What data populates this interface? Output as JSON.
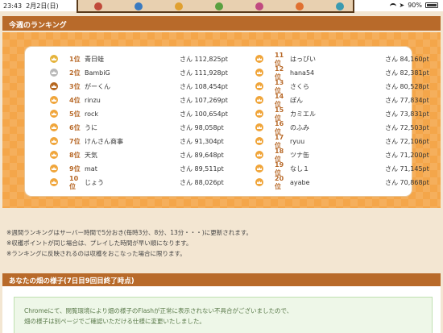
{
  "status_bar": {
    "time": "23:43",
    "date": "2月2日(日)",
    "battery": "90%"
  },
  "weekly_ranking": {
    "title": "今週のランキング",
    "score_prefix": "さん",
    "rows": [
      {
        "rank": "1位",
        "name": "青日蛙",
        "score": "112,825pt",
        "crown": "#e5b33a"
      },
      {
        "rank": "2位",
        "name": "BambiG",
        "score": "111,928pt",
        "crown": "#b8b8b8"
      },
      {
        "rank": "3位",
        "name": "がーくん",
        "score": "108,454pt",
        "crown": "#b5651d"
      },
      {
        "rank": "4位",
        "name": "rinzu",
        "score": "107,269pt",
        "crown": "#f0a53a"
      },
      {
        "rank": "5位",
        "name": "rock",
        "score": "100,654pt",
        "crown": "#f0a53a"
      },
      {
        "rank": "6位",
        "name": "うに",
        "score": "98,058pt",
        "crown": "#f0a53a"
      },
      {
        "rank": "7位",
        "name": "けんさん商事",
        "score": "91,304pt",
        "crown": "#f0a53a"
      },
      {
        "rank": "8位",
        "name": "天気",
        "score": "89,648pt",
        "crown": "#f0a53a"
      },
      {
        "rank": "9位",
        "name": "mat",
        "score": "89,511pt",
        "crown": "#f0a53a"
      },
      {
        "rank": "10位",
        "name": "じょう",
        "score": "88,026pt",
        "crown": "#f0a53a"
      },
      {
        "rank": "11位",
        "name": "はっぴい",
        "score": "84,160pt",
        "crown": "#f0a53a"
      },
      {
        "rank": "12位",
        "name": "hana54",
        "score": "82,381pt",
        "crown": "#f0a53a"
      },
      {
        "rank": "13位",
        "name": "さくら",
        "score": "80,528pt",
        "crown": "#f0a53a"
      },
      {
        "rank": "14位",
        "name": "ぽん",
        "score": "77,834pt",
        "crown": "#f0a53a"
      },
      {
        "rank": "15位",
        "name": "カミエル",
        "score": "73,831pt",
        "crown": "#f0a53a"
      },
      {
        "rank": "16位",
        "name": "のふみ",
        "score": "72,503pt",
        "crown": "#f0a53a"
      },
      {
        "rank": "17位",
        "name": "ryuu",
        "score": "72,106pt",
        "crown": "#f0a53a"
      },
      {
        "rank": "18位",
        "name": "ツナ缶",
        "score": "71,200pt",
        "crown": "#f0a53a"
      },
      {
        "rank": "19位",
        "name": "なし１",
        "score": "71,145pt",
        "crown": "#f0a53a"
      },
      {
        "rank": "20位",
        "name": "ayabe",
        "score": "70,868pt",
        "crown": "#f0a53a"
      }
    ]
  },
  "notes": [
    "※週間ランキングはサーバー時間で5分おき(毎時3分、8分、13分・・・)に更新されます。",
    "※収穫ポイントが同じ場合は、プレイした時間が早い順になります。",
    "※ランキングに反映されるのは収穫をおこなった場合に限ります。"
  ],
  "farm_section": {
    "title": "あなたの畑の様子(7日目9回目終了時点)",
    "message_line1": "Chromeにて、閲覧環境により畑の様子のFlashが正常に表示されない不具合がございましたので、",
    "message_line2": "畑の様子は別ページでご確認いただける仕様に変更いたしました。"
  },
  "colors": {
    "header": "#b86a2a",
    "board": "#f4a64a",
    "gold": "#e5b33a",
    "silver": "#b8b8b8",
    "bronze": "#b5651d"
  }
}
